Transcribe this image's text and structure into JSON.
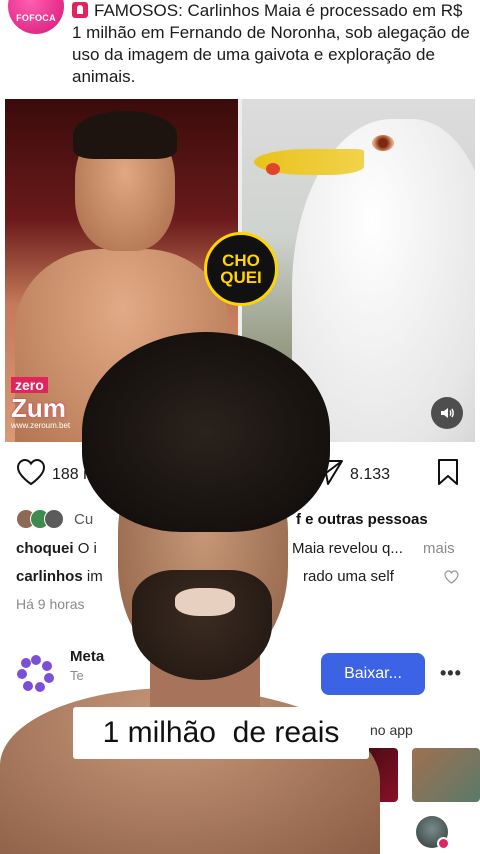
{
  "header": {
    "avatar_text": "FOFOCA",
    "post_text": "FAMOSOS: Carlinhos Maia é processado em R$ 1 milhão em Fernando de Noronha, sob alegação de uso da imagem de uma gaivota e exploração de animais."
  },
  "media": {
    "left_logo_top": "zero",
    "left_logo_main": "Zum",
    "left_logo_url": "www.zeroum.bet",
    "badge_line1": "CHO",
    "badge_line2": "QUEI",
    "sound_icon": "speaker-icon"
  },
  "actions": {
    "likes": "188 m",
    "shares": "8.133"
  },
  "liked_by": {
    "prefix": "Cu",
    "suffix": "f e outras pessoas"
  },
  "captions": [
    {
      "user": "choquei",
      "text": "O i",
      "rest": "Maia revelou q...",
      "more": "mais"
    },
    {
      "user": "carlinhos",
      "text": "im",
      "rest": "rado uma self"
    }
  ],
  "time_ago": "Há 9 horas",
  "ad": {
    "name": "Meta",
    "sub": "Te",
    "button": "Baixar...",
    "app_text": "no app",
    "thumb_text": "•••"
  },
  "subtitle": "1 milhão  de reais"
}
